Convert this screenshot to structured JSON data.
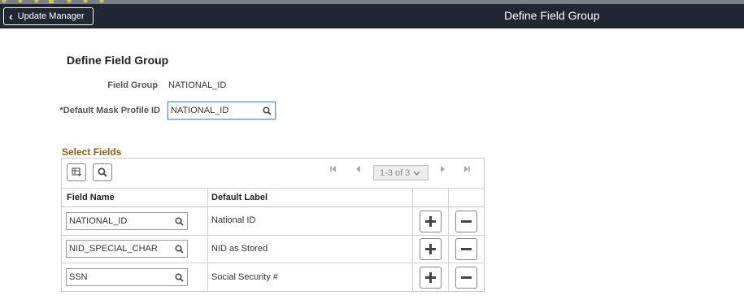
{
  "header": {
    "back_label": "Update Manager",
    "title": "Define Field Group"
  },
  "page": {
    "title": "Define Field Group"
  },
  "form": {
    "field_group_label": "Field Group",
    "field_group_value": "NATIONAL_ID",
    "mask_profile_label": "*Default Mask Profile ID",
    "mask_profile_value": "NATIONAL_ID"
  },
  "select_fields": {
    "title": "Select Fields",
    "pager_text": "1-3 of 3",
    "columns": [
      "Field Name",
      "Default Label"
    ],
    "rows": [
      {
        "field_name": "NATIONAL_ID",
        "default_label": "National ID"
      },
      {
        "field_name": "NID_SPECIAL_CHAR",
        "default_label": "NID as Stored"
      },
      {
        "field_name": "SSN",
        "default_label": "Social Security #"
      }
    ]
  },
  "colors": {
    "header_bg": "#1f2733",
    "section_title": "#8a5a1c",
    "focus_border": "#5b8fd6"
  }
}
